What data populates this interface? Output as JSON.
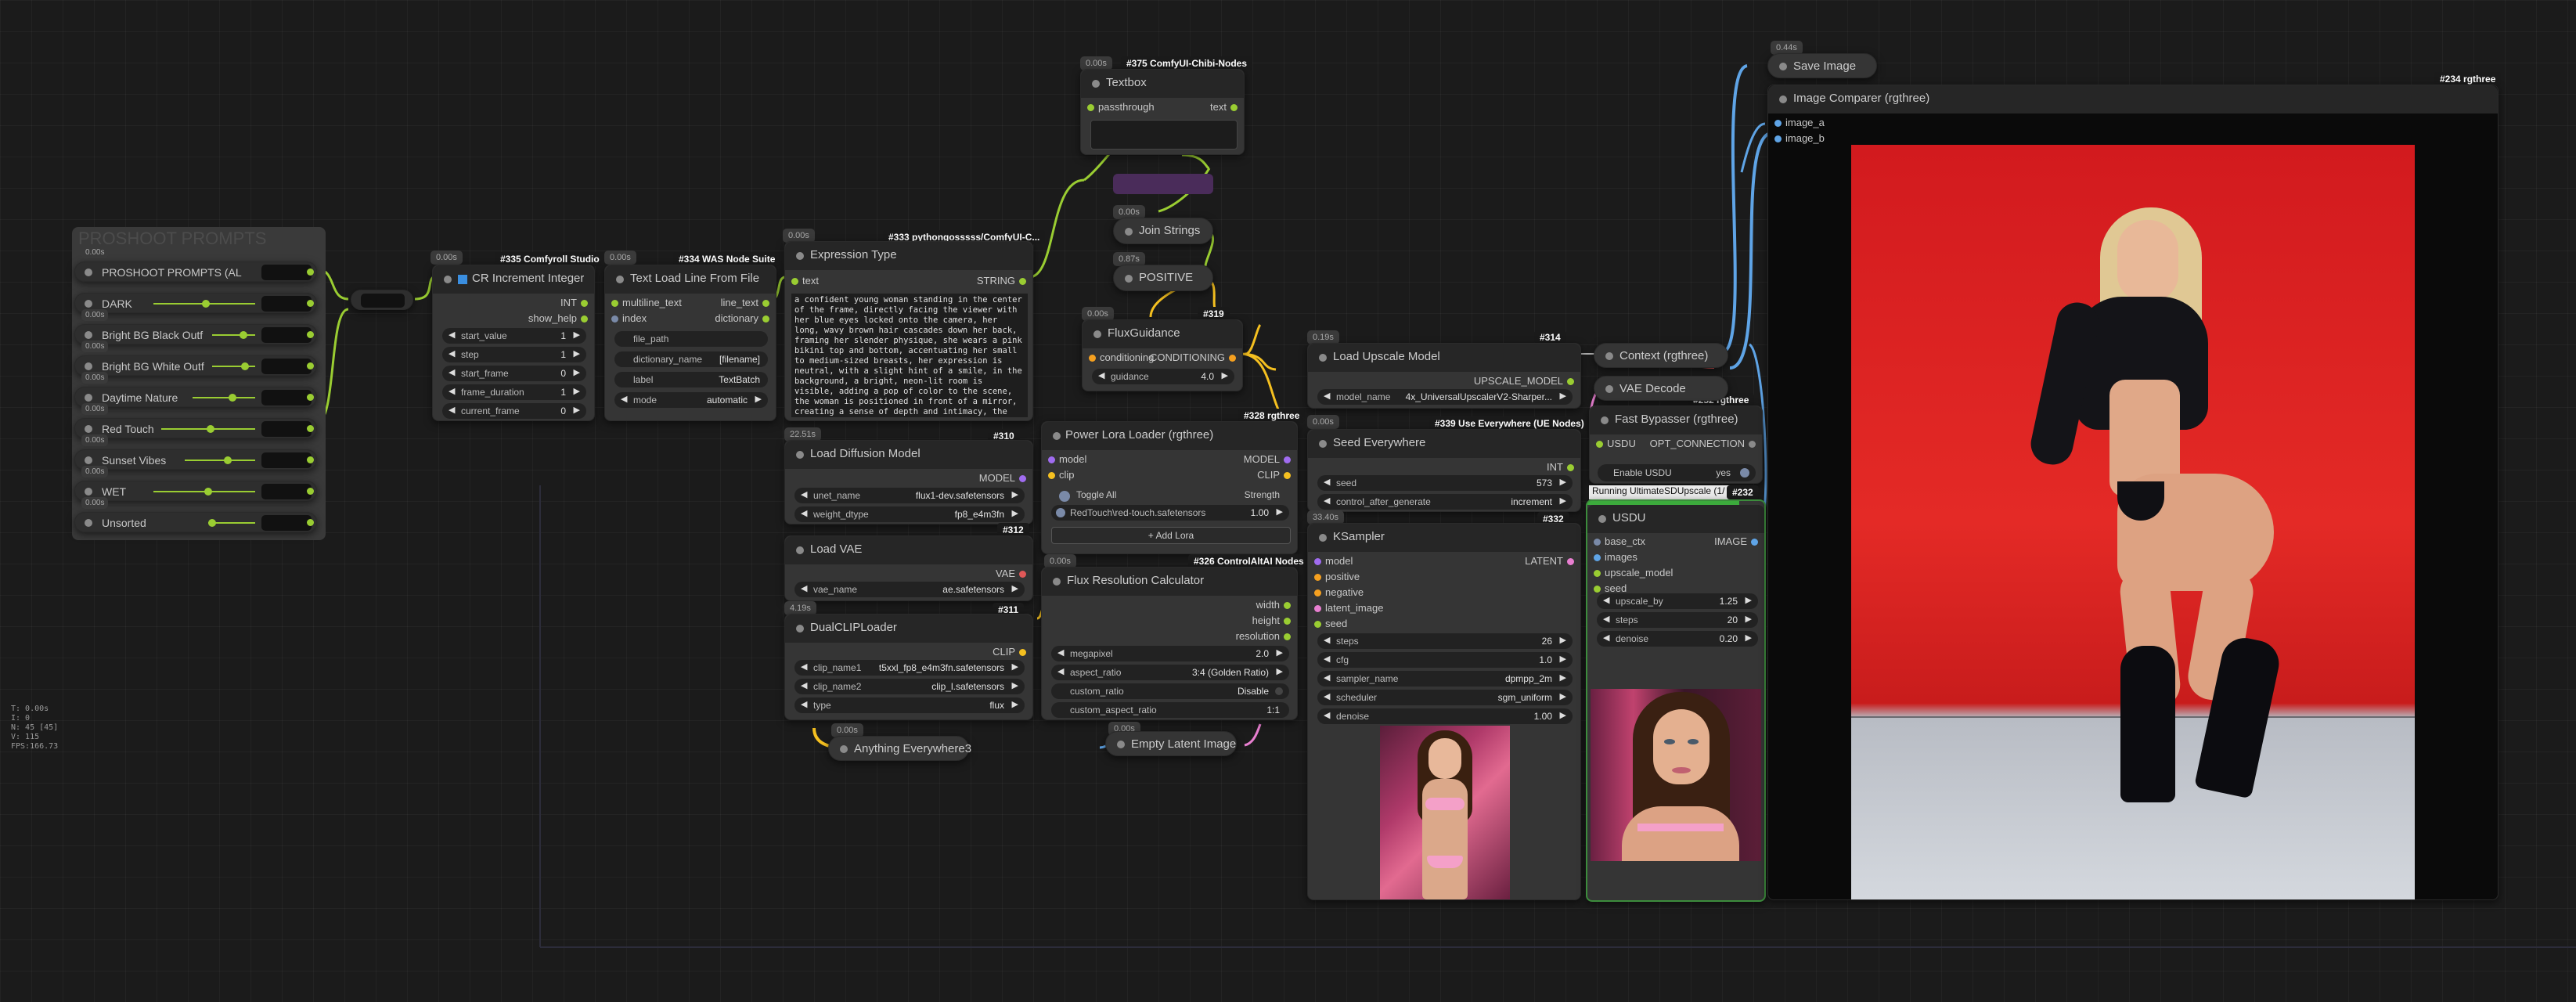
{
  "proshoot": {
    "title": "PROSHOOT PROMPTS",
    "rows": [
      {
        "time": "0.00s",
        "label": "PROSHOOT PROMPTS (AL"
      },
      {
        "time": "0.00s",
        "label": "DARK"
      },
      {
        "time": "0.00s",
        "label": "Bright BG Black Outf"
      },
      {
        "time": "0.00s",
        "label": "Bright BG White Outf"
      },
      {
        "time": "0.00s",
        "label": "Daytime Nature"
      },
      {
        "time": "0.00s",
        "label": "Red Touch"
      },
      {
        "time": "0.00s",
        "label": "Sunset Vibes"
      },
      {
        "time": "0.00s",
        "label": "WET"
      },
      {
        "time": "",
        "label": "Unsorted"
      }
    ]
  },
  "nodes": {
    "cr_increment": {
      "time": "0.00s",
      "source": "#335 Comfyroll Studio",
      "title": "CR Increment Integer",
      "out1": "INT",
      "out2": "show_help",
      "widgets": [
        {
          "label": "start_value",
          "value": "1"
        },
        {
          "label": "step",
          "value": "1"
        },
        {
          "label": "start_frame",
          "value": "0"
        },
        {
          "label": "frame_duration",
          "value": "1"
        },
        {
          "label": "current_frame",
          "value": "0"
        }
      ]
    },
    "text_load": {
      "time": "0.00s",
      "source": "#334 WAS Node Suite",
      "title": "Text Load Line From File",
      "in1": "multiline_text",
      "in2": "index",
      "out1": "line_text",
      "out2": "dictionary",
      "widgets": [
        {
          "label": "file_path",
          "value": ""
        },
        {
          "label": "dictionary_name",
          "value": "[filename]"
        },
        {
          "label": "label",
          "value": "TextBatch"
        },
        {
          "label": "mode",
          "value": "automatic"
        }
      ]
    },
    "expression": {
      "time": "0.00s",
      "source": "#333 pythongosssss/ComfyUI-C...",
      "title": "Expression Type",
      "in1": "text",
      "out1": "STRING",
      "text": "a confident young woman standing in the center of the frame, directly facing the viewer with her blue eyes locked onto the camera, her long, wavy brown hair cascades down her back, framing her slender physique, she wears a pink bikini top and bottom, accentuating her small to medium-sized breasts, her expression is neutral, with a slight hint of a smile, in the background, a bright, neon-lit room is visible, adding a pop of color to the scene, the woman is positioned in front of a mirror, creating a sense of depth and intimacy, the overall effect is one of calm and introspection, inviting the viewer to step into her world"
    },
    "textbox": {
      "time": "0.00s",
      "source": "#375 ComfyUI-Chibi-Nodes",
      "title": "Textbox",
      "in1": "passthrough",
      "out1": "text"
    },
    "join_strings": {
      "time": "0.00s",
      "title": "Join Strings"
    },
    "positive": {
      "time": "0.87s",
      "title": "POSITIVE"
    },
    "flux_guidance": {
      "time": "0.00s",
      "source": "#319",
      "title": "FluxGuidance",
      "in1": "conditioning",
      "out1": "CONDITIONING",
      "widgets": [
        {
          "label": "guidance",
          "value": "4.0"
        }
      ]
    },
    "load_diffusion": {
      "time": "22.51s",
      "source": "#310",
      "title": "Load Diffusion Model",
      "out1": "MODEL",
      "widgets": [
        {
          "label": "unet_name",
          "value": "flux1-dev.safetensors"
        },
        {
          "label": "weight_dtype",
          "value": "fp8_e4m3fn"
        }
      ]
    },
    "power_lora": {
      "time": "0.00s",
      "source": "#328 rgthree",
      "title": "Power Lora Loader (rgthree)",
      "in1": "model",
      "in2": "clip",
      "out1": "MODEL",
      "out2": "CLIP",
      "toggle_all": "Toggle All",
      "strength_label": "Strength",
      "lora_name": "RedTouch\\red-touch.safetensors",
      "lora_strength": "1.00",
      "add_lora": "+ Add Lora"
    },
    "load_vae": {
      "time": "0.00s",
      "source": "#312",
      "title": "Load VAE",
      "out1": "VAE",
      "widgets": [
        {
          "label": "vae_name",
          "value": "ae.safetensors"
        }
      ]
    },
    "flux_resolution": {
      "time": "0.00s",
      "source": "#326 ControlAltAI Nodes",
      "title": "Flux Resolution Calculator",
      "out1": "width",
      "out2": "height",
      "out3": "resolution",
      "widgets": [
        {
          "label": "megapixel",
          "value": "2.0"
        },
        {
          "label": "aspect_ratio",
          "value": "3:4 (Golden Ratio)"
        },
        {
          "label": "custom_ratio",
          "value": "Disable"
        },
        {
          "label": "custom_aspect_ratio",
          "value": "1:1"
        }
      ]
    },
    "dual_clip": {
      "time": "4.19s",
      "source": "#311",
      "title": "DualCLIPLoader",
      "out1": "CLIP",
      "widgets": [
        {
          "label": "clip_name1",
          "value": "t5xxl_fp8_e4m3fn.safetensors"
        },
        {
          "label": "clip_name2",
          "value": "clip_l.safetensors"
        },
        {
          "label": "type",
          "value": "flux"
        }
      ]
    },
    "anything_everywhere": {
      "time": "0.00s",
      "title": "Anything Everywhere3"
    },
    "empty_latent": {
      "time": "0.00s",
      "title": "Empty Latent Image"
    },
    "load_upscale": {
      "time": "0.19s",
      "source": "#314",
      "title": "Load Upscale Model",
      "out1": "UPSCALE_MODEL",
      "widgets": [
        {
          "label": "model_name",
          "value": "4x_UniversalUpscalerV2-Sharper..."
        }
      ]
    },
    "seed_everywhere": {
      "time": "0.00s",
      "source": "#339 Use Everywhere (UE Nodes)",
      "title": "Seed Everywhere",
      "out1": "INT",
      "widgets": [
        {
          "label": "seed",
          "value": "573"
        },
        {
          "label": "control_after_generate",
          "value": "increment"
        }
      ]
    },
    "ksampler": {
      "time": "33.40s",
      "source": "#332",
      "title": "KSampler",
      "inputs": [
        "model",
        "positive",
        "negative",
        "latent_image",
        "seed"
      ],
      "out1": "LATENT",
      "widgets": [
        {
          "label": "steps",
          "value": "26"
        },
        {
          "label": "cfg",
          "value": "1.0"
        },
        {
          "label": "sampler_name",
          "value": "dpmpp_2m"
        },
        {
          "label": "scheduler",
          "value": "sgm_uniform"
        },
        {
          "label": "denoise",
          "value": "1.00"
        }
      ]
    },
    "context": {
      "time": "",
      "title": "Context (rgthree)"
    },
    "vae_decode": {
      "time": "",
      "source": "#252 rgthree",
      "title": "VAE Decode"
    },
    "fast_bypasser": {
      "title": "Fast Bypasser (rgthree)",
      "in1": "USDU",
      "out1": "OPT_CONNECTION",
      "toggle_label": "Enable USDU",
      "toggle_value": "yes"
    },
    "usdu": {
      "running_label": "Running UltimateSDUpscale (1/",
      "source": "#232",
      "title": "USDU",
      "inputs": [
        "base_ctx",
        "images",
        "upscale_model",
        "seed"
      ],
      "out1": "IMAGE",
      "widgets": [
        {
          "label": "upscale_by",
          "value": "1.25"
        },
        {
          "label": "steps",
          "value": "20"
        },
        {
          "label": "denoise",
          "value": "0.20"
        }
      ]
    },
    "save_image": {
      "time": "0.44s",
      "title": "Save Image"
    },
    "image_comparer": {
      "source": "#234 rgthree",
      "title": "Image Comparer (rgthree)",
      "in1": "image_a",
      "in2": "image_b"
    }
  },
  "stats": [
    "T: 0.00s",
    "I: 0",
    "N: 45 [45]",
    "V: 115",
    "FPS:166.73"
  ],
  "colors": {
    "bg": "#1b1b1b",
    "node": "#353535",
    "header": "#262626",
    "wire_green": "#9acd32",
    "wire_yellow": "#f5c020",
    "wire_blue": "#5fa4e6",
    "wire_purple": "#a06cf0",
    "wire_pink": "#e87fd0",
    "wire_red": "#e05858",
    "usdu_border": "#3c8c3c"
  }
}
